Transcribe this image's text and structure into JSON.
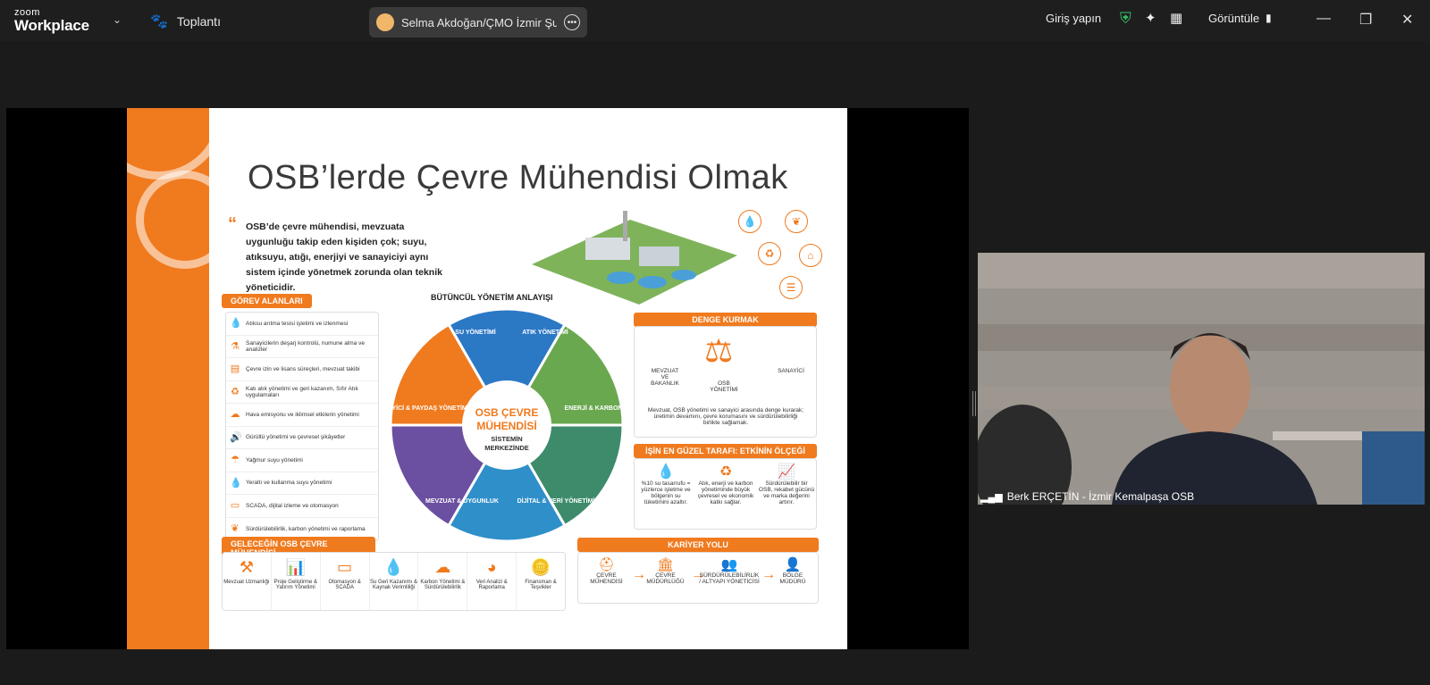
{
  "app": {
    "brand_top": "zoom",
    "brand_bottom": "Workplace",
    "meeting_label": "Toplantı",
    "title_tab": "Selma Akdoğan/ÇMO İzmir Şube",
    "signin": "Giriş yapın",
    "view_label": "Görüntüle"
  },
  "slide": {
    "title": "OSB’lerde Çevre Mühendisi Olmak",
    "quote": "OSB’de çevre mühendisi, mevzuata uygunluğu takip eden kişiden çok; suyu, atıksuyu, atığı, enerjiyi ve sanayiciyi aynı sistem içinde yönetmek zorunda olan teknik yöneticidir.",
    "gorev_title": "GÖREV ALANLARI",
    "gorev_items": [
      "Atıksu arıtma tesisi işletimi ve izlenmesi",
      "Sanayicilerin deşarj kontrolü, numune alma ve analizler",
      "Çevre izin ve lisans süreçleri, mevzuat takibi",
      "Katı atık yönetimi ve geri kazanım, Sıfır Atık uygulamaları",
      "Hava emisyonu ve iklimsel etkilerin yönetimi",
      "Gürültü yönetimi ve çevresel şikâyetler",
      "Yağmur suyu yönetimi",
      "Yeraltı ve kullanma suyu yönetimi",
      "SCADA, dijital izleme ve otomasyon",
      "Sürdürülebilirlik, karbon yönetimi ve raporlama"
    ],
    "wheel_title": "BÜTÜNCÜL YÖNETİM ANLAYIŞI",
    "wheel": {
      "center_line1": "OSB ÇEVRE",
      "center_line2": "MÜHENDİSİ",
      "center_line3": "SİSTEMİN",
      "center_line4": "MERKEZİNDE",
      "seg1": "SU YÖNETİMİ",
      "seg2": "ATIK YÖNETİMİ",
      "seg3": "ENERJİ & KARBON",
      "seg4": "DİJİTAL & VERİ YÖNETİMİ",
      "seg5": "MEVZUAT & UYGUNLUK",
      "seg6": "SANAYİCİ & PAYDAŞ YÖNETİMİ",
      "colors": [
        "#2b78c5",
        "#6aa84f",
        "#3d8b6a",
        "#2f8fc9",
        "#6b4fa0",
        "#f07a1e"
      ]
    },
    "denge_title": "DENGE KURMAK",
    "denge_left": "MEVZUAT VE BAKANLIK",
    "denge_mid": "OSB YÖNETİMİ",
    "denge_right": "SANAYİCİ",
    "denge_text": "Mevzuat, OSB yönetimi ve sanayici arasında denge kurarak; üretimin devamını, çevre korumasını ve sürdürülebilirliği birlikte sağlamak.",
    "olc_title": "İŞİN EN GÜZEL TARAFI: ETKİNİN ÖLÇEĞİ",
    "olc1": "%10 su tasarrufu = yüzlerce işletme ve bölgenin su tüketimini azaltır.",
    "olc2": "Atık, enerji ve karbon yönetiminde büyük çevresel ve ekonomik katkı sağlar.",
    "olc3": "Sürdürülebilir bir OSB, rekabet gücünü ve marka değerini artırır.",
    "kariyer_title": "KARİYER YOLU",
    "kariyer": [
      "ÇEVRE MÜHENDİSİ",
      "ÇEVRE MÜDÜRLÜĞÜ",
      "SÜRDÜRÜLEBİLİRLİK / ALTYAPI YÖNETİCİSİ",
      "BÖLGE MÜDÜRÜ"
    ],
    "gelecek_title": "GELECEĞİN OSB ÇEVRE MÜHENDİSİ",
    "gelecek": [
      "Mevzuat Uzmanlığı",
      "Proje Geliştirme & Yatırım Yönetimi",
      "Otomasyon & SCADA",
      "Su Geri Kazanımı & Kaynak Verimliliği",
      "Karbon Yönetimi & Sürdürülebilirlik",
      "Veri Analizi & Raporlama",
      "Finansman & Teşvikler"
    ]
  },
  "participant": {
    "name": "Berk ERÇETİN - İzmir Kemalpaşa OSB"
  }
}
